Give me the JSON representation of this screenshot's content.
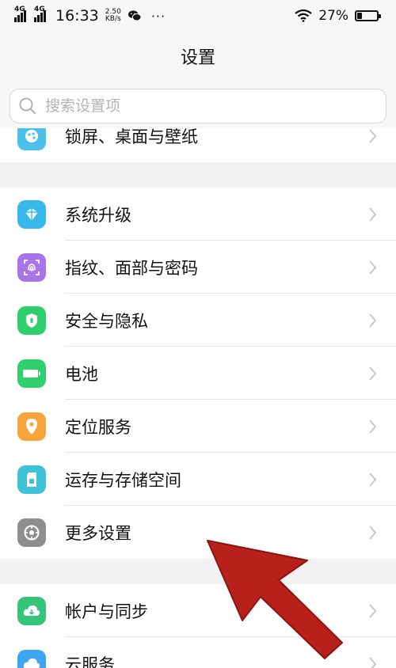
{
  "status_bar": {
    "sim1": "4G",
    "sim2": "4G",
    "time": "16:33",
    "speed_value": "2.50",
    "speed_unit": "KB/s",
    "more": "···",
    "battery": "27%",
    "battery_level": 0.27
  },
  "header": {
    "title": "设置"
  },
  "search": {
    "placeholder": "搜索设置项"
  },
  "groups": [
    {
      "items": [
        {
          "label": "锁屏、桌面与壁纸",
          "icon": "theme-icon",
          "color": "#4cc0e8"
        }
      ]
    },
    {
      "items": [
        {
          "label": "系统升级",
          "icon": "system-update-icon",
          "color": "#36b8ea"
        },
        {
          "label": "指纹、面部与密码",
          "icon": "fingerprint-icon",
          "color": "#a874e8"
        },
        {
          "label": "安全与隐私",
          "icon": "shield-icon",
          "color": "#2fcf6e"
        },
        {
          "label": "电池",
          "icon": "battery-icon",
          "color": "#2fcf6e"
        },
        {
          "label": "定位服务",
          "icon": "location-icon",
          "color": "#f7a43a"
        },
        {
          "label": "运存与存储空间",
          "icon": "storage-icon",
          "color": "#3ec2d8"
        },
        {
          "label": "更多设置",
          "icon": "gear-icon",
          "color": "#8e8e8e"
        }
      ]
    },
    {
      "items": [
        {
          "label": "帐户与同步",
          "icon": "sync-icon",
          "color": "#34c47a"
        },
        {
          "label": "云服务",
          "icon": "cloud-icon",
          "color": "#3da6f0"
        }
      ]
    }
  ],
  "colors": {
    "annotation_arrow": "#b8201c"
  }
}
